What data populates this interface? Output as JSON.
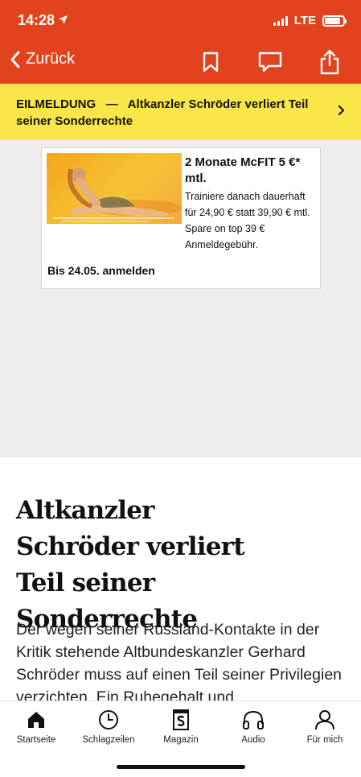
{
  "status_bar": {
    "time": "14:28",
    "network": "LTE",
    "battery_level": 0.85
  },
  "nav": {
    "back_label": "Zurück"
  },
  "breaking": {
    "tag": "EILMELDUNG",
    "separator": "—",
    "text": "Altkanzler Schröder verliert Teil seiner Sonderrechte"
  },
  "ad": {
    "title": "2 Monate McFIT 5 €* mtl.",
    "body": "Trainiere danach dauerhaft für 24,90 € statt 39,90 € mtl. Spare on top 39 € Anmeldegebühr.",
    "cta": "Bis 24.05. anmelden"
  },
  "article": {
    "headline": "Altkanzler Schröder verliert Teil seiner Sonderrechte",
    "lead": "Der wegen seiner Russland-Kontakte in der Kritik stehende Altbundeskanzler Gerhard Schröder muss auf einen Teil seiner Privilegien verzichten. Ein Ruhegehalt und"
  },
  "tabbar": {
    "items": [
      {
        "label": "Startseite",
        "icon": "home-icon"
      },
      {
        "label": "Schlagzeilen",
        "icon": "clock-icon"
      },
      {
        "label": "Magazin",
        "icon": "magazine-icon"
      },
      {
        "label": "Audio",
        "icon": "headphones-icon"
      },
      {
        "label": "Für mich",
        "icon": "person-icon"
      }
    ]
  },
  "colors": {
    "brand_red": "#E2431F",
    "breaking_yellow": "#FBE64A",
    "ad_background": "#EEEDEB"
  }
}
